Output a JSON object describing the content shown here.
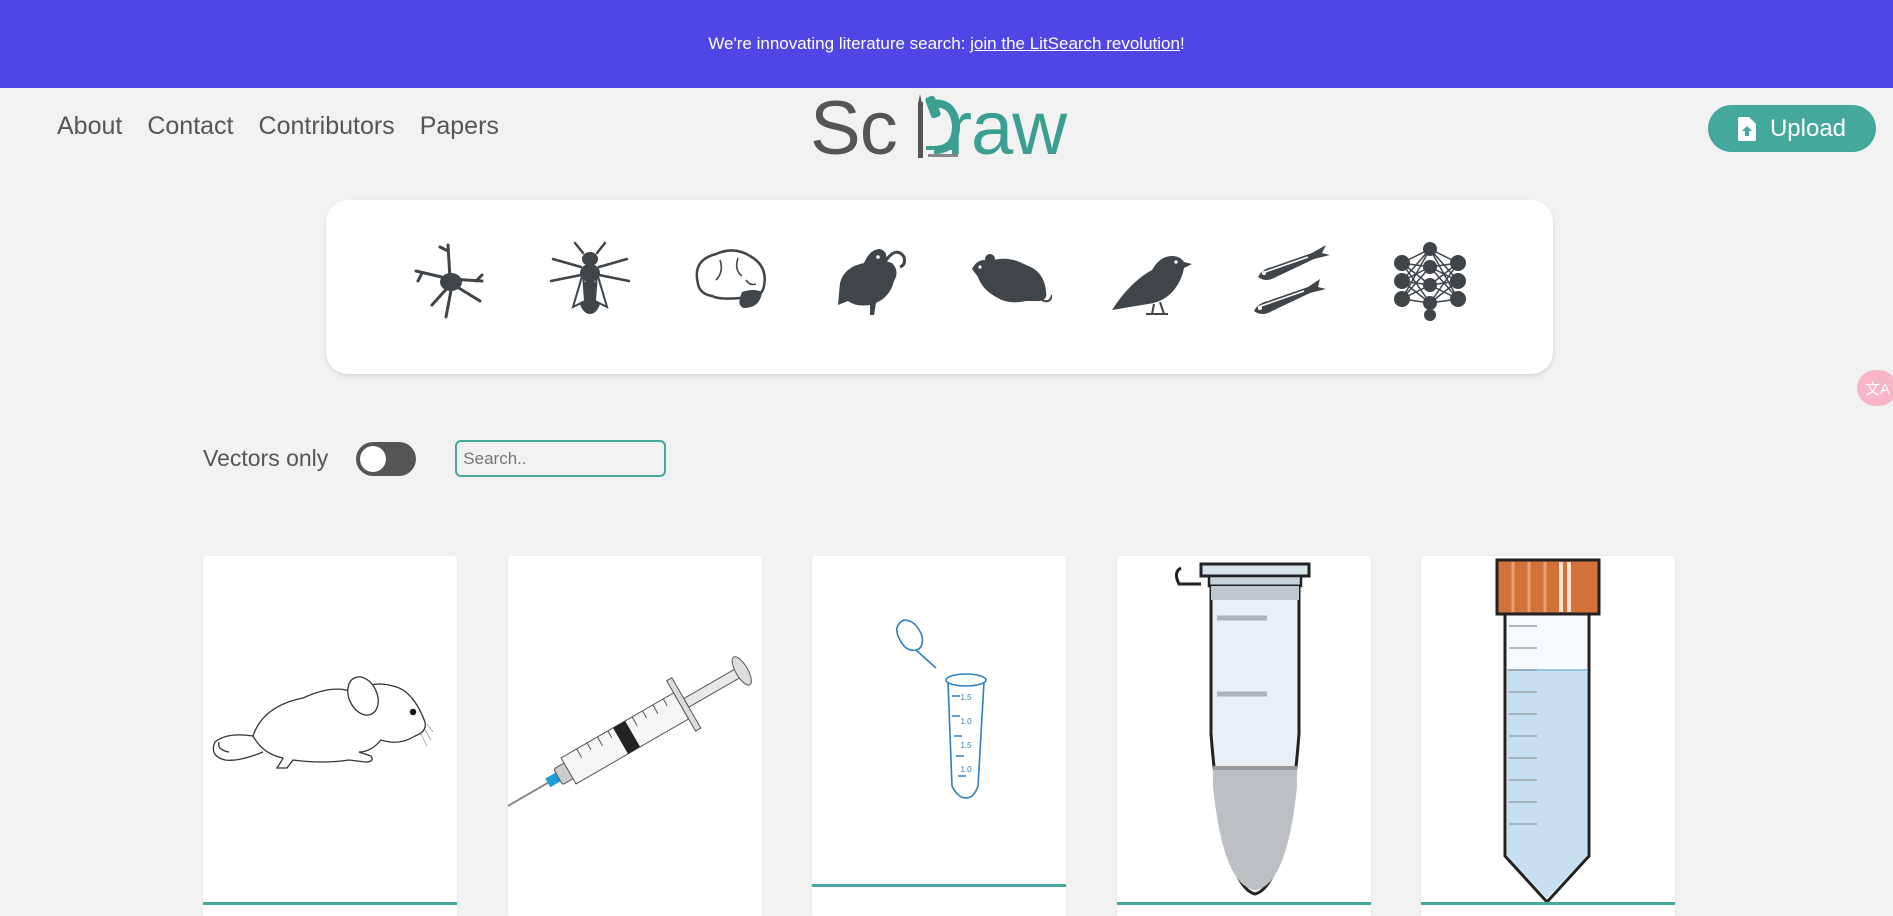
{
  "banner": {
    "text_prefix": "We're innovating literature search: ",
    "link_text": "join the LitSearch revolution",
    "text_suffix": "!"
  },
  "nav": [
    "About",
    "Contact",
    "Contributors",
    "Papers"
  ],
  "logo": {
    "part1": "Sc",
    "part2": "raw"
  },
  "upload": {
    "label": "Upload",
    "icon": "file-upload-icon"
  },
  "translate": {
    "glyph": "文A",
    "icon": "translate-icon"
  },
  "categories": [
    {
      "name": "neuron",
      "icon": "neuron-icon"
    },
    {
      "name": "fly",
      "icon": "fly-icon"
    },
    {
      "name": "brain",
      "icon": "brain-icon"
    },
    {
      "name": "rodent",
      "icon": "rodent-icon"
    },
    {
      "name": "mouse",
      "icon": "mouse-icon"
    },
    {
      "name": "bird",
      "icon": "bird-icon"
    },
    {
      "name": "zebrafish",
      "icon": "zebrafish-icon"
    },
    {
      "name": "network",
      "icon": "network-icon"
    }
  ],
  "filters": {
    "vectors_only_label": "Vectors only",
    "vectors_only_on": false,
    "search_placeholder": "Search.."
  },
  "cards": [
    {
      "name": "mouse-drawing"
    },
    {
      "name": "syringe"
    },
    {
      "name": "microcentrifuge-tube"
    },
    {
      "name": "eppendorf-tube"
    },
    {
      "name": "falcon-tube"
    }
  ],
  "colors": {
    "banner": "#4f46e5",
    "accent": "#45a89c",
    "logo_dark": "#555555",
    "logo_teal": "#3a9e91",
    "icon_fill": "#40454a"
  }
}
